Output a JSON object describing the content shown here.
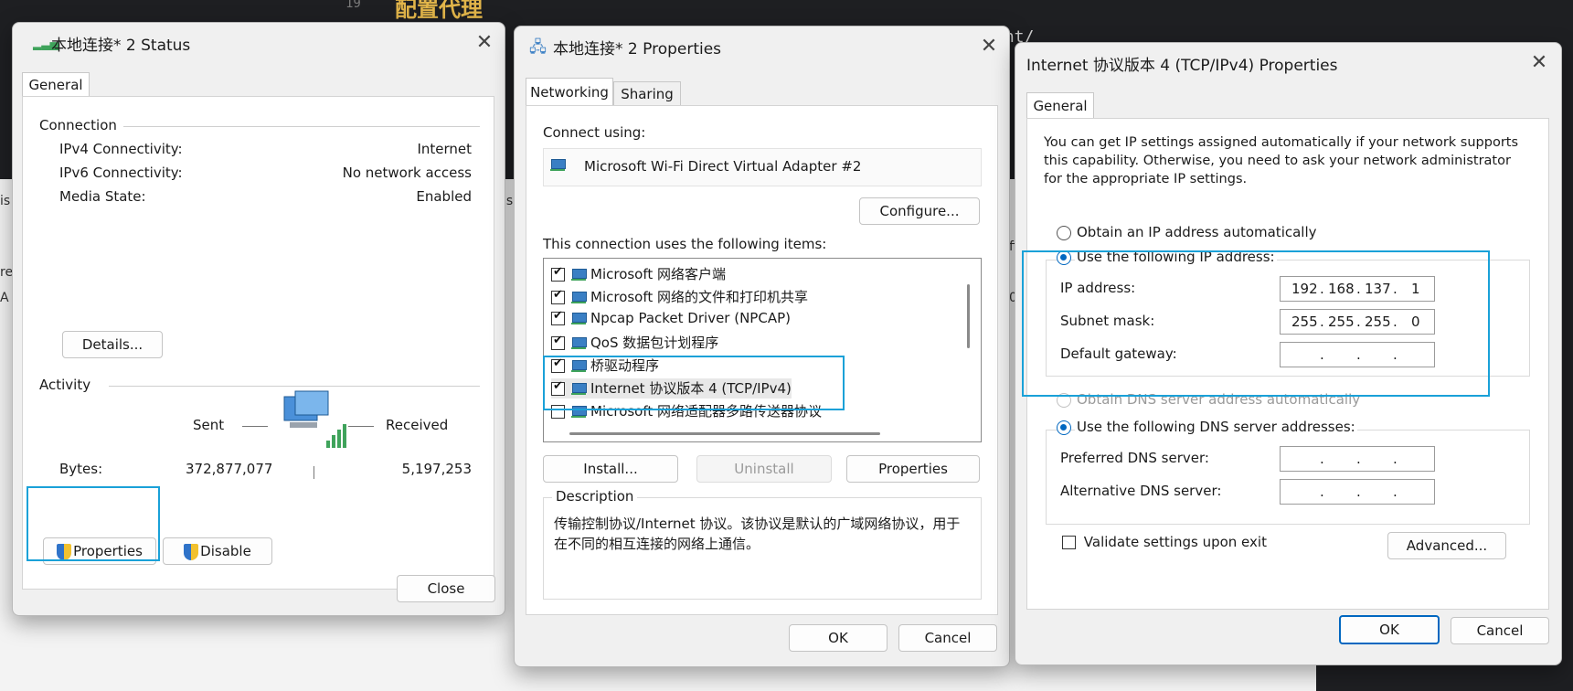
{
  "background": {
    "line_number": "19",
    "heading": "配置代理",
    "code_fragment": "ent/",
    "side_fragments": [
      "is",
      "re",
      "A",
      "is",
      "fi",
      "0"
    ]
  },
  "status_window": {
    "title": "本地连接* 2 Status",
    "tab": "General",
    "connection_heading": "Connection",
    "rows": [
      {
        "label": "IPv4 Connectivity:",
        "value": "Internet"
      },
      {
        "label": "IPv6 Connectivity:",
        "value": "No network access"
      },
      {
        "label": "Media State:",
        "value": "Enabled"
      }
    ],
    "details_button": "Details...",
    "activity_heading": "Activity",
    "sent_label": "Sent",
    "received_label": "Received",
    "bytes_label": "Bytes:",
    "bytes_sent": "372,877,077",
    "bytes_received": "5,197,253",
    "properties_button": "Properties",
    "disable_button": "Disable",
    "close_button": "Close"
  },
  "properties_window": {
    "title": "本地连接* 2 Properties",
    "tabs": [
      "Networking",
      "Sharing"
    ],
    "connect_using_label": "Connect using:",
    "adapter": "Microsoft Wi-Fi Direct Virtual Adapter #2",
    "configure_button": "Configure...",
    "items_label": "This connection uses the following items:",
    "items": [
      {
        "label": "Microsoft 网络客户端",
        "checked": true
      },
      {
        "label": "Microsoft 网络的文件和打印机共享",
        "checked": true
      },
      {
        "label": "Npcap Packet Driver (NPCAP)",
        "checked": true
      },
      {
        "label": "QoS 数据包计划程序",
        "checked": true
      },
      {
        "label": "桥驱动程序",
        "checked": true
      },
      {
        "label": "Internet 协议版本 4 (TCP/IPv4)",
        "checked": true
      },
      {
        "label": "Microsoft 网络适配器多路传送器协议",
        "checked": false
      }
    ],
    "install_button": "Install...",
    "uninstall_button": "Uninstall",
    "properties_button": "Properties",
    "description_heading": "Description",
    "description_text": "传输控制协议/Internet 协议。该协议是默认的广域网络协议，用于在不同的相互连接的网络上通信。",
    "ok_button": "OK",
    "cancel_button": "Cancel"
  },
  "ipv4_window": {
    "title": "Internet 协议版本 4 (TCP/IPv4) Properties",
    "tab": "General",
    "intro": [
      "You can get IP settings assigned automatically if your network supports",
      "this capability. Otherwise, you need to ask your network administrator",
      "for the appropriate IP settings."
    ],
    "obtain_ip_auto": "Obtain an IP address automatically",
    "use_following_ip": "Use the following IP address:",
    "ip_label": "IP address:",
    "ip_octets": [
      "192",
      "168",
      "137",
      "1"
    ],
    "subnet_label": "Subnet mask:",
    "subnet_octets": [
      "255",
      "255",
      "255",
      "0"
    ],
    "gateway_label": "Default gateway:",
    "obtain_dns_auto": "Obtain DNS server address automatically",
    "use_following_dns": "Use the following DNS server addresses:",
    "preferred_dns_label": "Preferred DNS server:",
    "alternate_dns_label": "Alternative DNS server:",
    "validate_label": "Validate settings upon exit",
    "advanced_button": "Advanced...",
    "ok_button": "OK",
    "cancel_button": "Cancel"
  },
  "colors": {
    "highlight": "#1aa1d8",
    "accent": "#0067c0"
  }
}
